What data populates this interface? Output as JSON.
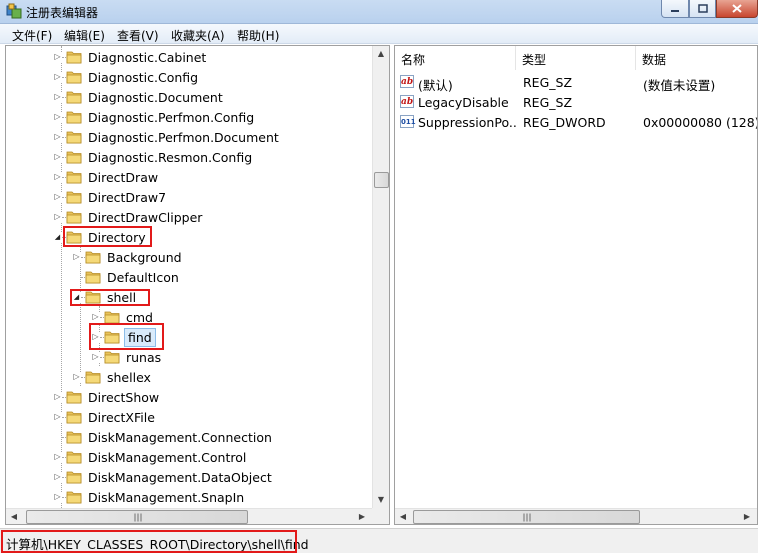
{
  "window": {
    "title": "注册表编辑器"
  },
  "menu": [
    "文件(F)",
    "编辑(E)",
    "查看(V)",
    "收藏夹(A)",
    "帮助(H)"
  ],
  "tree": [
    {
      "label": "Diagnostic.Cabinet",
      "indent": 0,
      "expander": "collapsed"
    },
    {
      "label": "Diagnostic.Config",
      "indent": 0,
      "expander": "collapsed"
    },
    {
      "label": "Diagnostic.Document",
      "indent": 0,
      "expander": "collapsed"
    },
    {
      "label": "Diagnostic.Perfmon.Config",
      "indent": 0,
      "expander": "collapsed"
    },
    {
      "label": "Diagnostic.Perfmon.Document",
      "indent": 0,
      "expander": "collapsed"
    },
    {
      "label": "Diagnostic.Resmon.Config",
      "indent": 0,
      "expander": "collapsed"
    },
    {
      "label": "DirectDraw",
      "indent": 0,
      "expander": "collapsed"
    },
    {
      "label": "DirectDraw7",
      "indent": 0,
      "expander": "collapsed"
    },
    {
      "label": "DirectDrawClipper",
      "indent": 0,
      "expander": "collapsed"
    },
    {
      "label": "Directory",
      "indent": 0,
      "expander": "expanded"
    },
    {
      "label": "Background",
      "indent": 1,
      "expander": "collapsed"
    },
    {
      "label": "DefaultIcon",
      "indent": 1,
      "expander": "none"
    },
    {
      "label": "shell",
      "indent": 1,
      "expander": "expanded"
    },
    {
      "label": "cmd",
      "indent": 2,
      "expander": "collapsed"
    },
    {
      "label": "find",
      "indent": 2,
      "expander": "collapsed",
      "selected": true
    },
    {
      "label": "runas",
      "indent": 2,
      "expander": "collapsed"
    },
    {
      "label": "shellex",
      "indent": 1,
      "expander": "collapsed"
    },
    {
      "label": "DirectShow",
      "indent": 0,
      "expander": "collapsed"
    },
    {
      "label": "DirectXFile",
      "indent": 0,
      "expander": "collapsed"
    },
    {
      "label": "DiskManagement.Connection",
      "indent": 0,
      "expander": "none"
    },
    {
      "label": "DiskManagement.Control",
      "indent": 0,
      "expander": "collapsed"
    },
    {
      "label": "DiskManagement.DataObject",
      "indent": 0,
      "expander": "collapsed"
    },
    {
      "label": "DiskManagement.SnapIn",
      "indent": 0,
      "expander": "collapsed"
    }
  ],
  "columns": {
    "name": "名称",
    "type": "类型",
    "data": "数据"
  },
  "values": [
    {
      "icon": "string-value-icon",
      "glyph": "ab",
      "name": "(默认)",
      "type": "REG_SZ",
      "data": "(数值未设置)"
    },
    {
      "icon": "string-value-icon",
      "glyph": "ab",
      "name": "LegacyDisable",
      "type": "REG_SZ",
      "data": ""
    },
    {
      "icon": "binary-value-icon",
      "glyph": "011",
      "name": "SuppressionPo...",
      "type": "REG_DWORD",
      "data": "0x00000080 (128)"
    }
  ],
  "status": {
    "path": "计算机\\HKEY_CLASSES_ROOT\\Directory\\shell\\find"
  },
  "colors": {
    "highlight_box": "#e21a1a",
    "selection": "#d9ebfb",
    "folder": "#e8c25a"
  }
}
